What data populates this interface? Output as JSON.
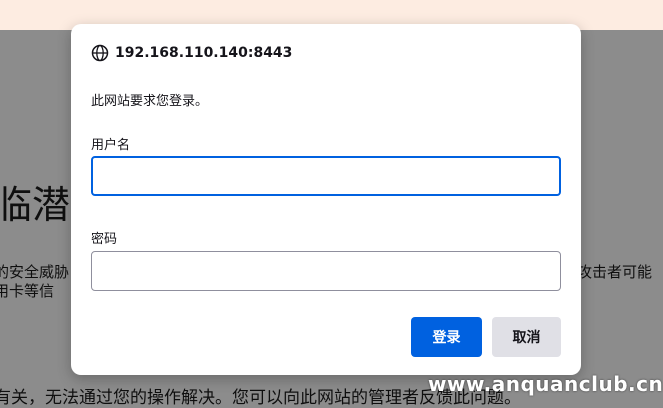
{
  "background_page": {
    "heading_fragment": "临潜",
    "paragraph1_line1": "的安全威胁",
    "paragraph1_line2": "用卡等信",
    "paragraph1_right": "攻击者可能",
    "paragraph2": "有关，无法通过您的操作解决。您可以向此网站的管理者反馈此问题。"
  },
  "dialog": {
    "origin": "192.168.110.140:8443",
    "origin_icon": "globe-icon",
    "message": "此网站要求您登录。",
    "username_label": "用户名",
    "username_value": "",
    "password_label": "密码",
    "password_value": "",
    "login_button": "登录",
    "cancel_button": "取消"
  },
  "colors": {
    "primary": "#0061e0",
    "secondary": "#e0e0e6",
    "banner": "#fdece1"
  },
  "watermark": "www.anquanclub.cn"
}
